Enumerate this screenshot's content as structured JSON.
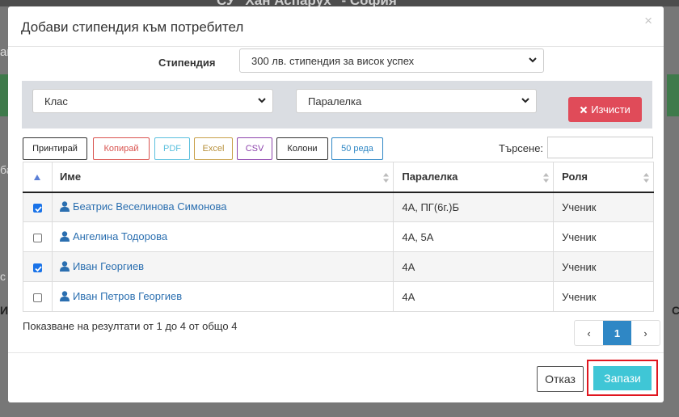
{
  "background": {
    "title": "СУ \"Хан Аспарух\" - София",
    "left_a": "ак",
    "left_b": "ба",
    "left_c": "с",
    "left_d": "Ин",
    "right_d": "С"
  },
  "modal": {
    "title": "Добави стипендия към потребител",
    "close": "×"
  },
  "scholarship": {
    "label": "Стипендия",
    "selected": "300 лв. стипендия за висок успех"
  },
  "filters": {
    "class_selected": "Клас",
    "section_selected": "Паралелка",
    "clear_label": "Изчисти"
  },
  "toolbar": {
    "print": "Принтирай",
    "copy": "Копирай",
    "pdf": "PDF",
    "excel": "Excel",
    "csv": "CSV",
    "columns": "Колони",
    "rows": "50 реда",
    "search_label": "Търсене:",
    "search_value": ""
  },
  "table": {
    "headers": {
      "name": "Име",
      "section": "Паралелка",
      "role": "Роля"
    },
    "rows": [
      {
        "checked": true,
        "name": "Беатрис Веселинова Симонова",
        "section": "4А, ПГ(6г.)Б",
        "role": "Ученик"
      },
      {
        "checked": false,
        "name": "Ангелина Тодорова",
        "section": "4А, 5А",
        "role": "Ученик"
      },
      {
        "checked": true,
        "name": "Иван Георгиев",
        "section": "4А",
        "role": "Ученик"
      },
      {
        "checked": false,
        "name": "Иван Петров Георгиев",
        "section": "4А",
        "role": "Ученик"
      }
    ]
  },
  "pagination": {
    "info": "Показване на резултати от 1 до 4 от общо 4",
    "prev": "‹",
    "current": "1",
    "next": "›"
  },
  "footer": {
    "cancel": "Отказ",
    "save": "Запази"
  },
  "colors": {
    "primary_link": "#2b6fb0",
    "danger": "#e04b59",
    "info": "#3fc6d6",
    "page_active": "#2f87c5",
    "highlight": "#e0161f"
  }
}
